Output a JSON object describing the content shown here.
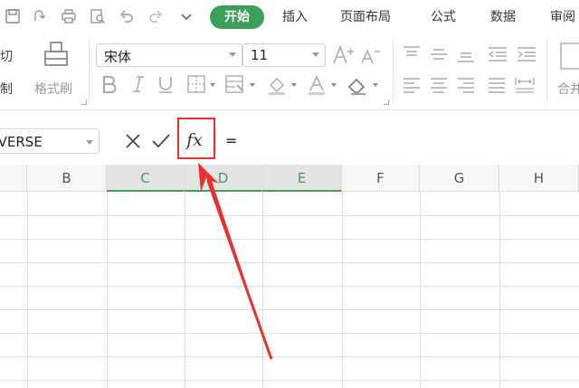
{
  "menu": {
    "tabs": [
      "开始",
      "插入",
      "页面布局",
      "公式",
      "数据",
      "审阅"
    ]
  },
  "ribbon": {
    "cut_label": "剪切",
    "copy_label": "复制",
    "format_painter_label": "格式刷",
    "font_name": "宋体",
    "font_size": "11",
    "merge_label": "合并"
  },
  "formula_bar": {
    "name_box": "INVERSE",
    "fx_label": "fx",
    "formula": "="
  },
  "grid": {
    "columns": [
      "B",
      "C",
      "D",
      "E",
      "F",
      "G",
      "H"
    ],
    "selected_columns": [
      "C",
      "D",
      "E"
    ]
  },
  "colors": {
    "accent_green": "#3aa05a",
    "highlight_red": "#e8302e"
  }
}
